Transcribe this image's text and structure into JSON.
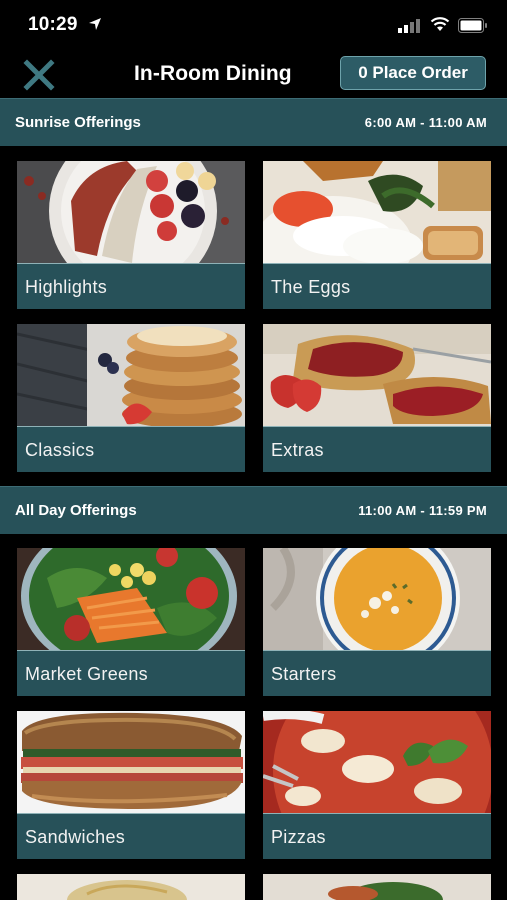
{
  "status_bar": {
    "time": "10:29"
  },
  "nav": {
    "title": "In-Room Dining",
    "order_button": "0 Place Order"
  },
  "sections": [
    {
      "title": "Sunrise Offerings",
      "hours": "6:00 AM - 11:00 AM",
      "items": [
        {
          "label": "Highlights",
          "image": "acai-bowl"
        },
        {
          "label": "The Eggs",
          "image": "eggs-breakfast-plate"
        },
        {
          "label": "Classics",
          "image": "pancake-stack"
        },
        {
          "label": "Extras",
          "image": "toast-with-jam"
        }
      ]
    },
    {
      "title": "All Day Offerings",
      "hours": "11:00 AM - 11:59 PM",
      "items": [
        {
          "label": "Market Greens",
          "image": "salad-bowl"
        },
        {
          "label": "Starters",
          "image": "soup-bowl"
        },
        {
          "label": "Sandwiches",
          "image": "sandwich"
        },
        {
          "label": "Pizzas",
          "image": "pizza"
        }
      ]
    }
  ],
  "colors": {
    "section_bar": "#275159",
    "button": "#2d5c66",
    "background": "#000000"
  }
}
